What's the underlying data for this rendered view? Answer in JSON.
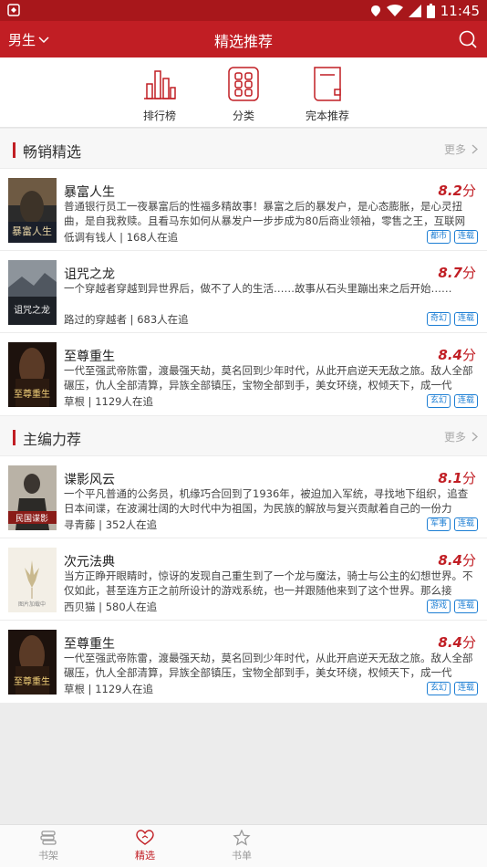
{
  "status_bar": {
    "time": "11:45"
  },
  "header": {
    "gender_label": "男生",
    "title": "精选推荐"
  },
  "quick_nav": [
    {
      "label": "排行榜",
      "icon": "ranking-icon"
    },
    {
      "label": "分类",
      "icon": "category-icon"
    },
    {
      "label": "完本推荐",
      "icon": "book-complete-icon"
    }
  ],
  "sections": [
    {
      "title": "畅销精选",
      "more": "更多",
      "books": [
        {
          "title": "暴富人生",
          "score": "8.2",
          "unit": "分",
          "desc": "普通银行员工一夜暴富后的性福多精故事！暴富之后的暴发户，是心态膨胀，是心灵扭曲，是自我救赎。且看马东如何从暴发户一步步成为80后商业领袖，零售之王，互联网",
          "author": "低调有钱人",
          "readers": "168人在追",
          "tags": [
            "都市",
            "连载"
          ],
          "cover_text": "暴富人生"
        },
        {
          "title": "诅咒之龙",
          "score": "8.7",
          "unit": "分",
          "desc": "一个穿越者穿越到异世界后，做不了人的生活……故事从石头里蹦出来之后开始……",
          "author": "路过的穿越者",
          "readers": "683人在追",
          "tags": [
            "奇幻",
            "连载"
          ],
          "cover_text": "诅咒之龙"
        },
        {
          "title": "至尊重生",
          "score": "8.4",
          "unit": "分",
          "desc": "一代至强武帝陈雷，渡最强天劫，莫名回到少年时代，从此开启逆天无敌之旅。敌人全部碾压，仇人全部清算，异族全部镇压，宝物全部到手，美女环绕，权倾天下，成一代",
          "author": "草根",
          "readers": "1129人在追",
          "tags": [
            "玄幻",
            "连载"
          ],
          "cover_text": "至尊重生"
        }
      ]
    },
    {
      "title": "主编力荐",
      "more": "更多",
      "books": [
        {
          "title": "谍影风云",
          "score": "8.1",
          "unit": "分",
          "desc": "一个平凡普通的公务员，机缘巧合回到了1936年，被迫加入军统，寻找地下组织，追查日本间谍，在波澜壮阔的大时代中为祖国，为民族的解放与复兴贡献着自己的一份力",
          "author": "寻青藤",
          "readers": "352人在追",
          "tags": [
            "军事",
            "连载"
          ],
          "cover_text": "民国谍影"
        },
        {
          "title": "次元法典",
          "score": "8.4",
          "unit": "分",
          "desc": "当方正睁开眼睛时，惊讶的发现自己重生到了一个龙与魔法，骑士与公主的幻想世界。不仅如此，甚至连方正之前所设计的游戏系统，也一并跟随他来到了这个世界。那么接",
          "author": "西贝猫",
          "readers": "580人在追",
          "tags": [
            "游戏",
            "连载"
          ],
          "cover_text": "图片加载中"
        },
        {
          "title": "至尊重生",
          "score": "8.4",
          "unit": "分",
          "desc": "一代至强武帝陈雷，渡最强天劫，莫名回到少年时代，从此开启逆天无敌之旅。敌人全部碾压，仇人全部清算，异族全部镇压，宝物全部到手，美女环绕，权倾天下，成一代",
          "author": "草根",
          "readers": "1129人在追",
          "tags": [
            "玄幻",
            "连载"
          ],
          "cover_text": "至尊重生"
        }
      ]
    }
  ],
  "bottom_nav": [
    {
      "label": "书架",
      "icon": "bookshelf-icon",
      "active": false
    },
    {
      "label": "精选",
      "icon": "heart-icon",
      "active": true
    },
    {
      "label": "书单",
      "icon": "star-icon",
      "active": false
    }
  ],
  "colors": {
    "brand": "#c11e24",
    "status_bar": "#a8171b",
    "tag_blue": "#1e7fd4"
  }
}
